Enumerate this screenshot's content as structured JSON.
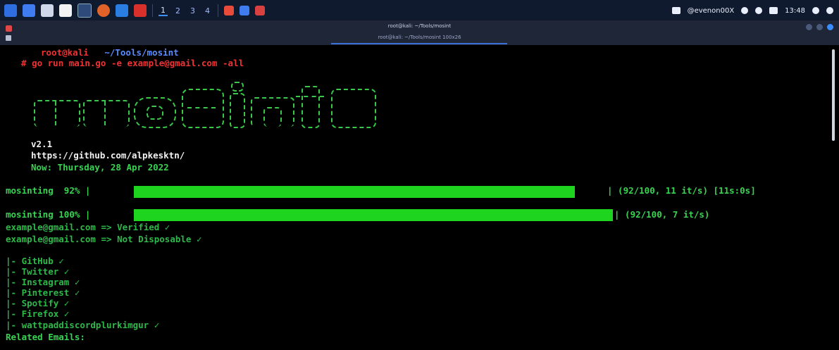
{
  "taskbar": {
    "workspaces": [
      "1",
      "2",
      "3",
      "4"
    ],
    "active_workspace": "1",
    "user": "@evenon00X",
    "clock": "13:48"
  },
  "window": {
    "title": "root@kali: ~/Tools/mosint",
    "tab_title": "root@kali: ~/Tools/mosint 100x26"
  },
  "terminal": {
    "prompt_user": "root@kali",
    "prompt_path": "~/Tools/mosint",
    "prompt_symbol": "#",
    "command": "go run main.go",
    "flag_e": "-e",
    "email_arg": "example@gmail.com",
    "flag_all": "-all",
    "logo_text": "mosint",
    "version": "v2.1",
    "github": "https://github.com/alpkesktn/",
    "now": "Now: Thursday, 28 Apr 2022",
    "progress": [
      {
        "label": "mosinting",
        "percent": "92%",
        "stats": "| (92/100, 11 it/s) [11s:0s]",
        "fraction": 0.92
      },
      {
        "label": "mosinting",
        "percent": "100%",
        "stats": "| (92/100, 7 it/s)",
        "fraction": 1.0
      }
    ],
    "email_checks": [
      {
        "email": "example@gmail.com",
        "arrow": "=>",
        "status": "Verified ✓"
      },
      {
        "email": "example@gmail.com",
        "arrow": "=>",
        "status": "Not Disposable ✓"
      }
    ],
    "services": [
      "|- GitHub ✓",
      "|- Twitter ✓",
      "|- Instagram ✓",
      "|- Pinterest ✓",
      "|- Spotify ✓",
      "|- Firefox ✓",
      "|- wattpaddiscordplurkimgur ✓"
    ],
    "related_emails": "Related Emails:"
  },
  "colors": {
    "bar_green": "#1ed41e",
    "prompt_red": "#ee3333",
    "prompt_blue": "#5a8cff",
    "text_green": "#39d353"
  }
}
